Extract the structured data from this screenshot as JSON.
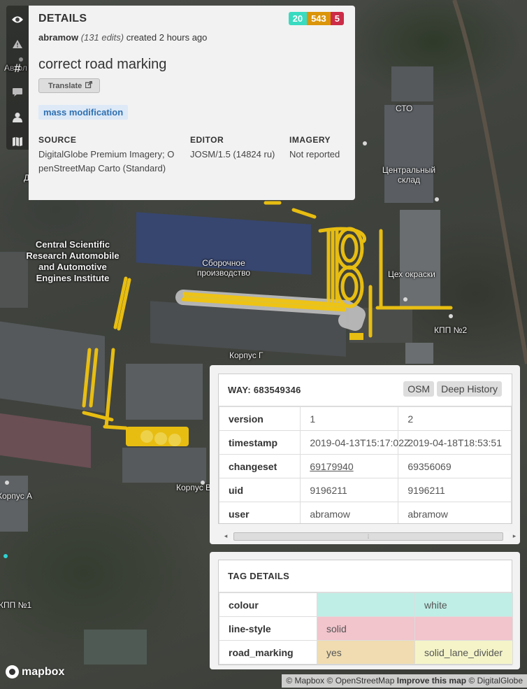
{
  "sidebar": {
    "icons": [
      "eye-icon",
      "warning-icon",
      "hash-icon",
      "comment-icon",
      "user-icon",
      "map-icon"
    ]
  },
  "details": {
    "title": "DETAILS",
    "counts": {
      "added": "20",
      "modified": "543",
      "deleted": "5"
    },
    "user": "abramow",
    "edits": "(131 edits)",
    "created": "created 2 hours ago",
    "comment": "correct road marking",
    "translate_label": "Translate",
    "flag": "mass modification",
    "source_label": "SOURCE",
    "source_value": "DigitalGlobe Premium Imagery; OpenStreetMap Carto (Standard)",
    "editor_label": "EDITOR",
    "editor_value": "JOSM/1.5 (14824 ru)",
    "imagery_label": "IMAGERY",
    "imagery_value": "Not reported"
  },
  "way": {
    "title": "WAY: 683549346",
    "osm_button": "OSM",
    "history_button": "Deep History",
    "rows": [
      {
        "key": "version",
        "v1": "1",
        "v2": "2"
      },
      {
        "key": "timestamp",
        "v1": "2019-04-13T15:17:02Z",
        "v2": "2019-04-18T18:53:51"
      },
      {
        "key": "changeset",
        "v1": "69179940",
        "v2": "69356069"
      },
      {
        "key": "uid",
        "v1": "9196211",
        "v2": "9196211"
      },
      {
        "key": "user",
        "v1": "abramow",
        "v2": "abramow"
      }
    ]
  },
  "tags": {
    "title": "TAG DETAILS",
    "rows": [
      {
        "key": "colour",
        "v1": "",
        "v2": "white"
      },
      {
        "key": "line-style",
        "v1": "solid",
        "v2": ""
      },
      {
        "key": "road_marking",
        "v1": "yes",
        "v2": "solid_lane_divider"
      }
    ]
  },
  "map_labels": {
    "sto": "СТО",
    "sklad": "Центральный склад",
    "sborochnoe": "Сборочное производство",
    "okraski": "Цех окраски",
    "kpp2": "КПП №2",
    "institute": "Central Scientific Research Automobile and Automotive Engines Institute",
    "korpus_g": "Корпус Г",
    "korpus_v": "Корпус В",
    "korpus_a": "Корпус А",
    "kpp1": "КПП №1",
    "avto": "Автол",
    "d": "Д"
  },
  "footer": {
    "logo": "mapbox",
    "attribution_1": "© Mapbox © OpenStreetMap",
    "attribution_improve": "Improve this map",
    "attribution_2": "© DigitalGlobe"
  }
}
